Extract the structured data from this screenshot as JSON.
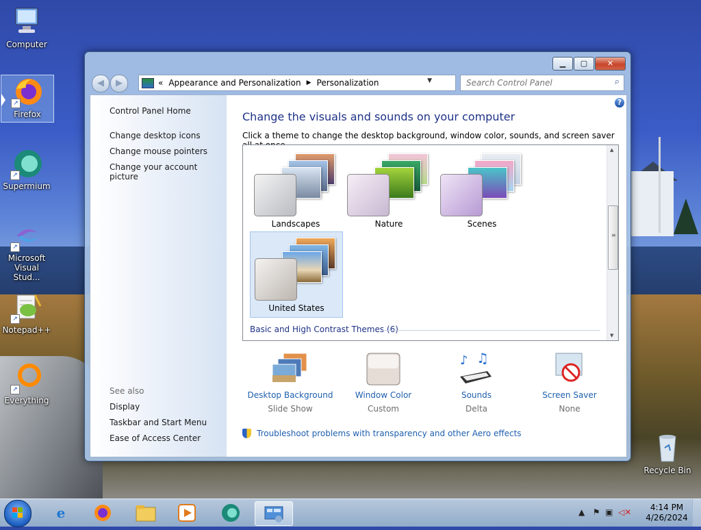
{
  "desktop": {
    "icons": [
      {
        "label": "Computer",
        "icon": "computer-icon"
      },
      {
        "label": "Firefox",
        "icon": "firefox-icon"
      },
      {
        "label": "Supermium",
        "icon": "supermium-icon"
      },
      {
        "label": "Microsoft Visual Stud...",
        "icon": "visual-studio-icon"
      },
      {
        "label": "Notepad++",
        "icon": "notepad-plus-plus-icon"
      },
      {
        "label": "Everything",
        "icon": "everything-icon"
      },
      {
        "label": "Recycle Bin",
        "icon": "recycle-bin-icon"
      }
    ]
  },
  "window": {
    "breadcrumb": {
      "prefix": "«",
      "items": [
        "Appearance and Personalization",
        "Personalization"
      ]
    },
    "search_placeholder": "Search Control Panel",
    "left_pane": {
      "home": "Control Panel Home",
      "links": [
        "Change desktop icons",
        "Change mouse pointers",
        "Change your account picture"
      ],
      "see_also_heading": "See also",
      "see_also": [
        "Display",
        "Taskbar and Start Menu",
        "Ease of Access Center"
      ]
    },
    "main": {
      "title": "Change the visuals and sounds on your computer",
      "description": "Click a theme to change the desktop background, window color, sounds, and screen saver all at once.",
      "themes": [
        {
          "name": "Landscapes",
          "selected": false
        },
        {
          "name": "Nature",
          "selected": false
        },
        {
          "name": "Scenes",
          "selected": false
        },
        {
          "name": "United States",
          "selected": true
        }
      ],
      "basic_group": "Basic and High Contrast Themes (6)",
      "settings": [
        {
          "label": "Desktop Background",
          "value": "Slide Show",
          "icon": "desktop-background-icon"
        },
        {
          "label": "Window Color",
          "value": "Custom",
          "icon": "window-color-icon"
        },
        {
          "label": "Sounds",
          "value": "Delta",
          "icon": "sounds-icon"
        },
        {
          "label": "Screen Saver",
          "value": "None",
          "icon": "screen-saver-icon"
        }
      ],
      "troubleshoot": "Troubleshoot problems with transparency and other Aero effects"
    }
  },
  "taskbar": {
    "apps": [
      "internet-explorer-icon",
      "firefox-icon",
      "file-explorer-icon",
      "media-player-icon",
      "supermium-icon",
      "control-panel-icon"
    ],
    "clock_time": "4:14 PM",
    "clock_date": "4/26/2024"
  },
  "colors": {
    "link": "#1e5fae",
    "title": "#1e3287",
    "selection": "#dbe8f8"
  }
}
